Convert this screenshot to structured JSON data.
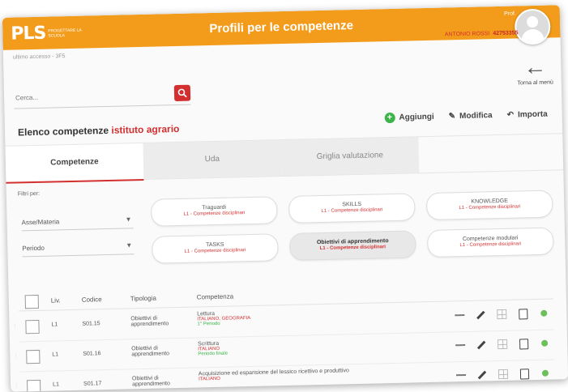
{
  "header": {
    "logo_mark": "PLS",
    "logo_sub": "PROGETTARE LA SCUOLA",
    "title": "Profili per le competenze",
    "user_small": "Prof.",
    "user_name": "ANTONIO ROSSI",
    "user_code": "42753355"
  },
  "breadcrumb": "ultimo accesso - 3F5",
  "back_label": "Torna al menù",
  "search": {
    "placeholder": "Cerca..."
  },
  "list": {
    "title_prefix": "Elenco competenze",
    "title_highlight": "istituto agrario"
  },
  "actions": {
    "add": "Aggiungi",
    "edit": "Modifica",
    "import": "Importa"
  },
  "tabs": [
    {
      "label": "Competenze"
    },
    {
      "label": "Uda"
    },
    {
      "label": "Griglia valutazione"
    }
  ],
  "filters": {
    "label": "Filtri per:",
    "subject": "Asse/Materia",
    "period": "Periodo"
  },
  "categories": [
    {
      "title": "Traguardi",
      "subtitle": "L1 - Competenze disciplinari"
    },
    {
      "title": "SKILLS",
      "subtitle": "L1 - Competenze disciplinari"
    },
    {
      "title": "KNOWLEDGE",
      "subtitle": "L1 - Competenze disciplinari"
    },
    {
      "title": "TASKS",
      "subtitle": "L1 - Competenze disciplinari"
    },
    {
      "title": "Obiettivi di apprendimento",
      "subtitle": "L1 - Competenze disciplinari"
    },
    {
      "title": "Competenze modulari",
      "subtitle": "L1 - Competenze disciplinari"
    }
  ],
  "table": {
    "columns": {
      "lev": "Liv.",
      "code": "Codice",
      "type": "Tipologia",
      "competence": "Competenza"
    },
    "rows": [
      {
        "lev": "L1",
        "code": "S01.15",
        "type": "Obiettivi di apprendimento",
        "competence": "Lettura",
        "subject": "ITALIANO, GEOGRAFIA",
        "period": "1° Periodo"
      },
      {
        "lev": "L1",
        "code": "S01.16",
        "type": "Obiettivi di apprendimento",
        "competence": "Scrittura",
        "subject": "ITALIANO",
        "period": "Periodo finale"
      },
      {
        "lev": "L1",
        "code": "S01.17",
        "type": "Obiettivi di apprendimento",
        "competence": "Acquisizione ed espansione del lessico ricettivo e produttivo",
        "subject": "ITALIANO",
        "period": ""
      }
    ]
  },
  "colors": {
    "brand": "#f39c1b",
    "accent": "#d32f2f",
    "ok": "#6cbf5a"
  }
}
